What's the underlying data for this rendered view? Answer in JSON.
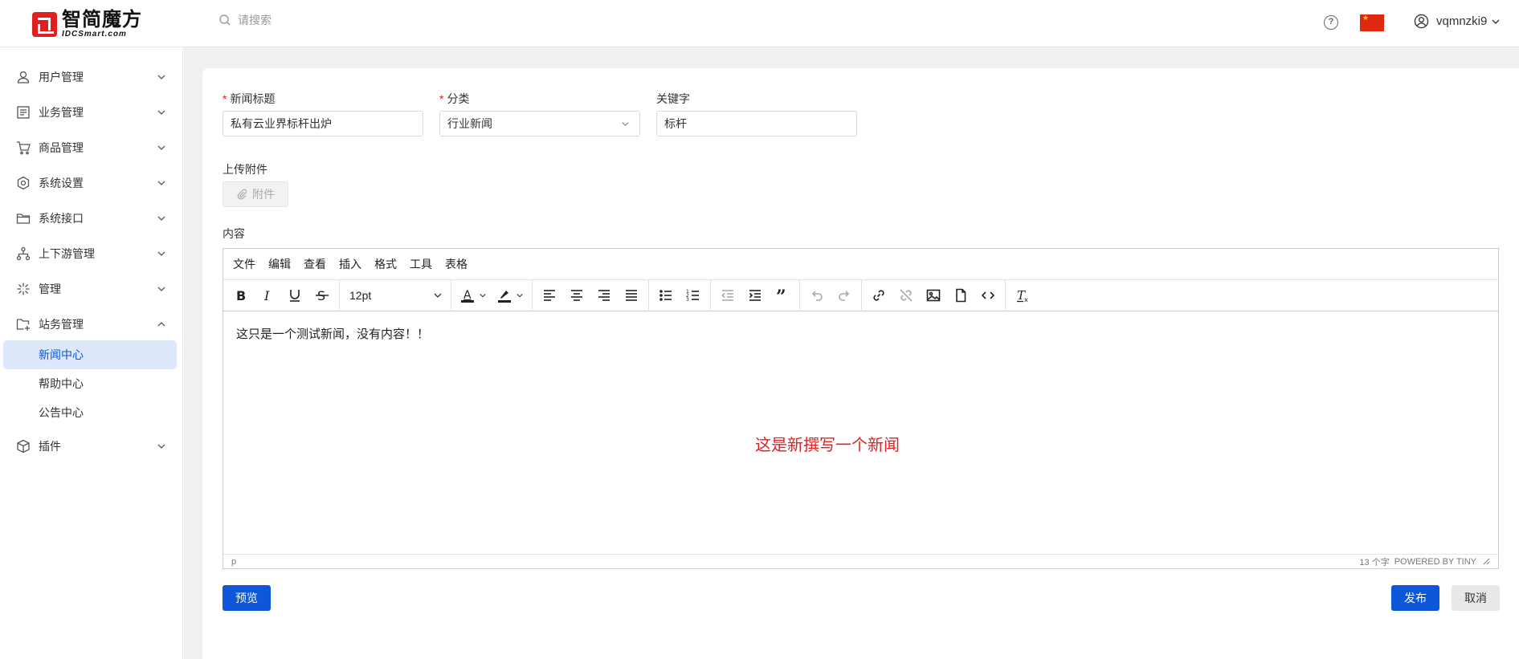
{
  "header": {
    "logo_cn": "智简魔方",
    "logo_en": "IDCSmart.com",
    "search_placeholder": "请搜索",
    "help_symbol": "?",
    "username": "vqmnzki9"
  },
  "sidebar": {
    "items": [
      {
        "label": "用户管理",
        "icon": "user-icon",
        "expanded": false
      },
      {
        "label": "业务管理",
        "icon": "list-icon",
        "expanded": false
      },
      {
        "label": "商品管理",
        "icon": "cart-icon",
        "expanded": false
      },
      {
        "label": "系统设置",
        "icon": "settings-icon",
        "expanded": false
      },
      {
        "label": "系统接口",
        "icon": "folder-icon",
        "expanded": false
      },
      {
        "label": "上下游管理",
        "icon": "network-icon",
        "expanded": false
      },
      {
        "label": "管理",
        "icon": "sparkle-icon",
        "expanded": false
      },
      {
        "label": "站务管理",
        "icon": "site-icon",
        "expanded": true
      },
      {
        "label": "插件",
        "icon": "cube-icon",
        "expanded": false
      }
    ],
    "subitems": [
      {
        "label": "新闻中心",
        "active": true
      },
      {
        "label": "帮助中心",
        "active": false
      },
      {
        "label": "公告中心",
        "active": false
      }
    ]
  },
  "form": {
    "title_label": "新闻标题",
    "title_value": "私有云业界标杆出炉",
    "category_label": "分类",
    "category_value": "行业新闻",
    "keyword_label": "关键字",
    "keyword_value": "标杆",
    "upload_label": "上传附件",
    "attach_button": "附件",
    "content_label": "内容",
    "required_mark": "*"
  },
  "editor": {
    "menus": [
      "文件",
      "编辑",
      "查看",
      "插入",
      "格式",
      "工具",
      "表格"
    ],
    "font_size": "12pt",
    "content": "这只是一个测试新闻，没有内容！！",
    "path": "p",
    "word_count": "13 个字",
    "powered_by": "POWERED BY TINY"
  },
  "annotation": "这是新撰写一个新闻",
  "buttons": {
    "preview": "预览",
    "publish": "发布",
    "cancel": "取消"
  },
  "colors": {
    "accent": "#0d57d9",
    "annotation": "#e02020",
    "active_bg": "#dde8fb"
  }
}
